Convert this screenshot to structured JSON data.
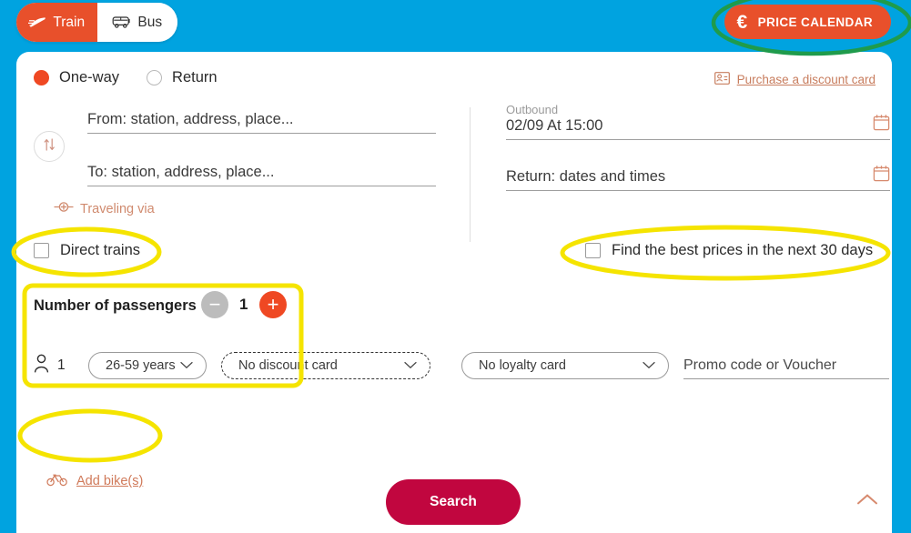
{
  "header": {
    "tabs": [
      {
        "label": "Train",
        "icon": "train-icon",
        "active": true
      },
      {
        "label": "Bus",
        "icon": "bus-icon",
        "active": false
      }
    ],
    "price_calendar": {
      "label": "PRICE CALENDAR",
      "icon": "euro-icon",
      "symbol": "€"
    }
  },
  "trip": {
    "radios": [
      {
        "label": "One-way",
        "selected": true
      },
      {
        "label": "Return",
        "selected": false
      }
    ],
    "purchase_link": {
      "label": "Purchase a discount card",
      "icon": "discount-card-icon"
    },
    "from_placeholder": "From: station, address, place...",
    "to_placeholder": "To: station, address, place...",
    "swap_icon": "swap-vertical-icon",
    "via_link": {
      "label": "Traveling via",
      "icon": "plus-target-icon"
    },
    "outbound": {
      "label": "Outbound",
      "value": "02/09 At 15:00",
      "icon": "calendar-icon"
    },
    "return": {
      "placeholder": "Return: dates and times",
      "icon": "calendar-icon"
    }
  },
  "options": {
    "direct_trains": {
      "label": "Direct trains",
      "checked": false
    },
    "best_prices": {
      "label": "Find the best prices in the next 30 days",
      "checked": false
    }
  },
  "passengers": {
    "title": "Number of passengers",
    "count": "1",
    "decrement_label": "−",
    "increment_label": "+",
    "row": {
      "person_icon": "person-icon",
      "index": "1",
      "age": "26-59 years",
      "discount_card": "No discount card",
      "loyalty_card": "No loyalty card",
      "promo_placeholder": "Promo code or Voucher",
      "chevron_icon": "chevron-down-icon"
    }
  },
  "bike_link": {
    "label": "Add bike(s)",
    "icon": "bike-icon"
  },
  "search_button": {
    "label": "Search"
  },
  "collapse_icon": "chevron-up-icon",
  "colors": {
    "page_background": "#00a3e0",
    "accent_orange": "#e8502b",
    "search_red": "#c1063f",
    "link_brown": "#c87d5e",
    "annotation_yellow": "#f5e400",
    "annotation_green": "#1f9b4c"
  },
  "annotations": [
    {
      "shape": "ellipse",
      "color": "#1f9b4c",
      "target": "price-calendar-button"
    },
    {
      "shape": "ellipse",
      "color": "#f5e400",
      "target": "direct-trains-checkbox"
    },
    {
      "shape": "ellipse",
      "color": "#f5e400",
      "target": "best-prices-checkbox"
    },
    {
      "shape": "rectangle",
      "color": "#f5e400",
      "target": "passengers-panel"
    },
    {
      "shape": "ellipse",
      "color": "#f5e400",
      "target": "add-bikes-link"
    }
  ]
}
